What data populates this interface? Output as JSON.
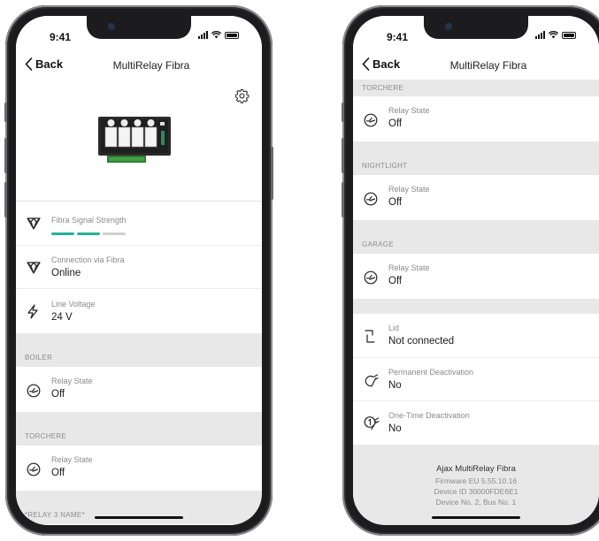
{
  "status": {
    "time": "9:41"
  },
  "nav": {
    "back_label": "Back",
    "title": "MultiRelay Fibra"
  },
  "colors": {
    "signal_on": "#21b39a",
    "signal_off": "#cfcfcf",
    "section_bg": "#e8e8e8"
  },
  "left": {
    "signal_strength": {
      "label": "Fibra Signal Strength",
      "level": 2,
      "max": 3
    },
    "connection": {
      "label": "Connection via Fibra",
      "value": "Online"
    },
    "line_voltage": {
      "label": "Line Voltage",
      "value": "24 V"
    },
    "boiler": {
      "section": "BOILER",
      "label": "Relay State",
      "value": "Off"
    },
    "torchere": {
      "section": "TORCHERE",
      "label": "Relay State",
      "value": "Off"
    },
    "relay3": {
      "section": "*RELAY 3 NAME*"
    }
  },
  "right": {
    "torchere": {
      "section": "TORCHERE",
      "label": "Relay State",
      "value": "Off"
    },
    "nightlight": {
      "section": "NIGHTLIGHT",
      "label": "Relay State",
      "value": "Off"
    },
    "garage": {
      "section": "GARAGE",
      "label": "Relay State",
      "value": "Off"
    },
    "lid": {
      "label": "Lid",
      "value": "Not connected"
    },
    "permanent": {
      "label": "Permanent Deactivation",
      "value": "No"
    },
    "onetime": {
      "label": "One-Time Deactivation",
      "value": "No"
    },
    "footer": {
      "name": "Ajax MultiRelay Fibra",
      "firmware": "Firmware EU 5.55.10.16",
      "device_id": "Device ID 30000FDE6E1",
      "device_no": "Device No. 2, Bus No. 1"
    }
  }
}
